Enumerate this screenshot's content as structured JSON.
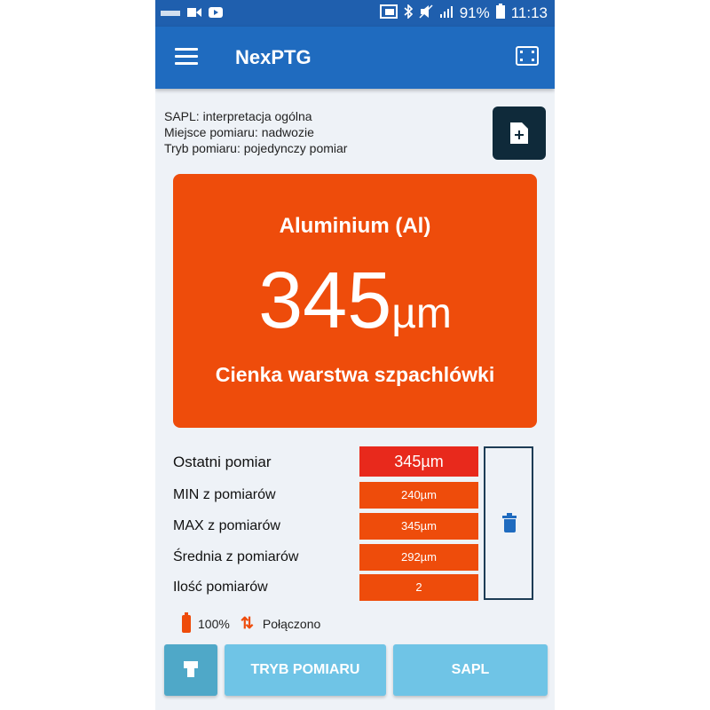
{
  "statusbar": {
    "battery": "91%",
    "time": "11:13"
  },
  "appbar": {
    "title": "NexPTG"
  },
  "info": {
    "line1": "SAPL: interpretacja ogólna",
    "line2": "Miejsce pomiaru: nadwozie",
    "line3": "Tryb pomiaru: pojedynczy pomiar"
  },
  "result": {
    "material": "Aluminium (Al)",
    "value": "345",
    "unit": "µm",
    "verdict": "Cienka warstwa szpachlówki"
  },
  "stats": [
    {
      "label": "Ostatni pomiar",
      "value": "345µm"
    },
    {
      "label": "MIN z pomiarów",
      "value": "240µm"
    },
    {
      "label": "MAX z pomiarów",
      "value": "345µm"
    },
    {
      "label": "Średnia z pomiarów",
      "value": "292µm"
    },
    {
      "label": "Ilość pomiarów",
      "value": "2"
    }
  ],
  "device": {
    "battery": "100%",
    "connection": "Połączono"
  },
  "buttons": {
    "mode": "TRYB POMIARU",
    "sapl": "SAPL"
  },
  "colors": {
    "primary": "#1f6bbf",
    "accent": "#ee4c0b",
    "last_value": "#e8291c",
    "button": "#6fc4e6"
  }
}
